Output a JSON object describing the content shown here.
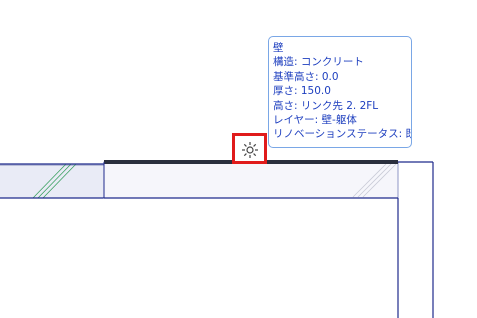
{
  "tooltip": {
    "title": "壁",
    "lines": [
      "構造: コンクリート",
      "基準高さ: 0.0",
      "厚さ: 150.0",
      "高さ: リンク先 2. 2FL",
      "レイヤー: 壁-躯体",
      "リノベーションステータス: 既存"
    ]
  },
  "cursor_icon": "snap-point-icon",
  "colors": {
    "tooltip_text": "#1e3fbf",
    "tooltip_border": "#7aa7e6",
    "wall_highlight": "#2a2f3d",
    "wall_outline": "#1f2a8c",
    "hatch": "#3aa060",
    "selection_frame": "#e01b1b"
  }
}
